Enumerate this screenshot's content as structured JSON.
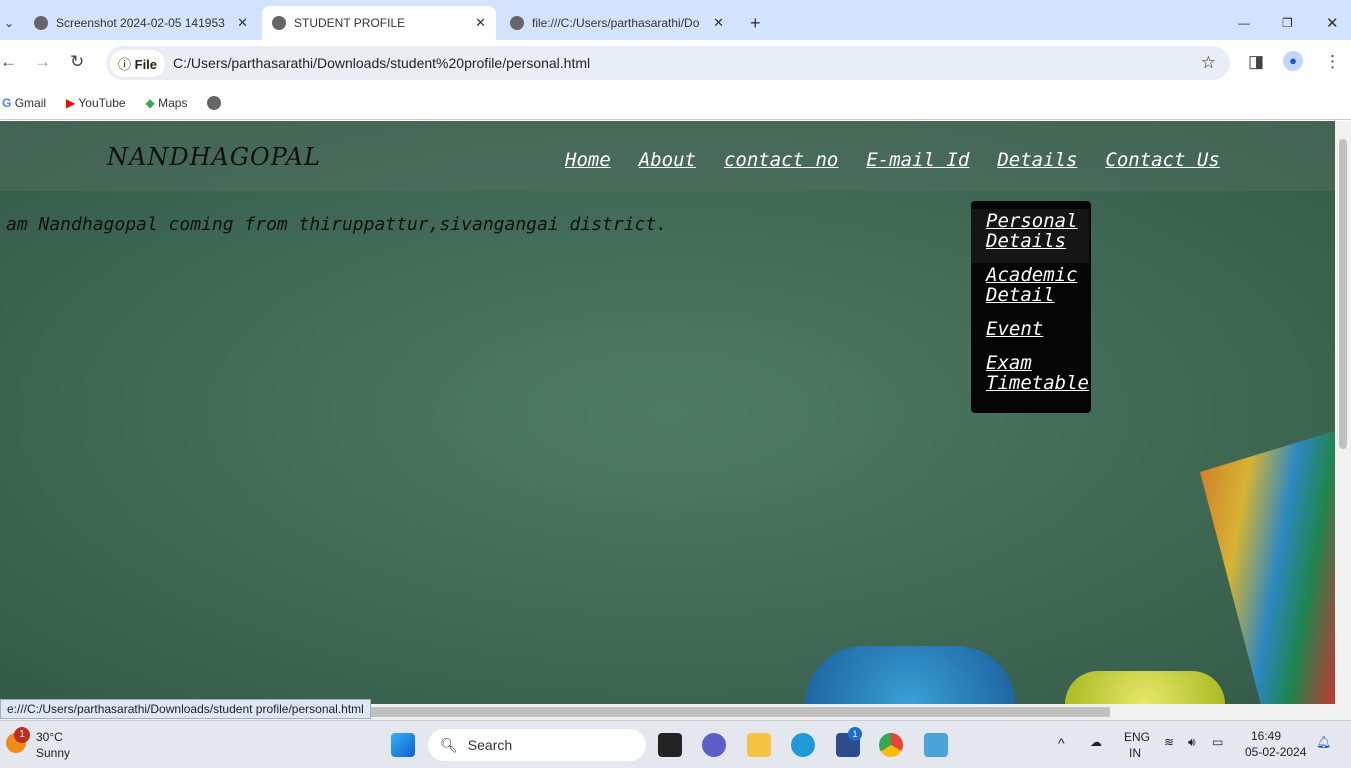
{
  "browser": {
    "tabs": [
      {
        "label": "Screenshot 2024-02-05 141953"
      },
      {
        "label": "STUDENT PROFILE",
        "active": true
      },
      {
        "label": "file:///C:/Users/parthasarathi/Do"
      }
    ],
    "address": {
      "chip": "File",
      "url": "C:/Users/parthasarathi/Downloads/student%20profile/personal.html"
    },
    "bookmarks": [
      {
        "label": "Gmail"
      },
      {
        "label": "YouTube"
      },
      {
        "label": "Maps"
      }
    ],
    "status_url": "e:///C:/Users/parthasarathi/Downloads/student profile/personal.html"
  },
  "page": {
    "logo": "NANDHAGOPAL",
    "nav": [
      {
        "label": "Home"
      },
      {
        "label": "About"
      },
      {
        "label": "contact no"
      },
      {
        "label": "E-mail Id"
      },
      {
        "label": "Details"
      },
      {
        "label": "Contact Us"
      }
    ],
    "dropdown": [
      {
        "label": "Personal Details"
      },
      {
        "label": "Academic Detail"
      },
      {
        "label": "Event"
      },
      {
        "label": "Exam Timetable"
      }
    ],
    "intro": "am Nandhagopal coming from thiruppattur,sivangangai district."
  },
  "taskbar": {
    "weather_temp": "30°C",
    "weather_desc": "Sunny",
    "weather_badge": "1",
    "search": "Search",
    "lang1": "ENG",
    "lang2": "IN",
    "time": "16:49",
    "date": "05-02-2024",
    "store_badge": "1"
  }
}
